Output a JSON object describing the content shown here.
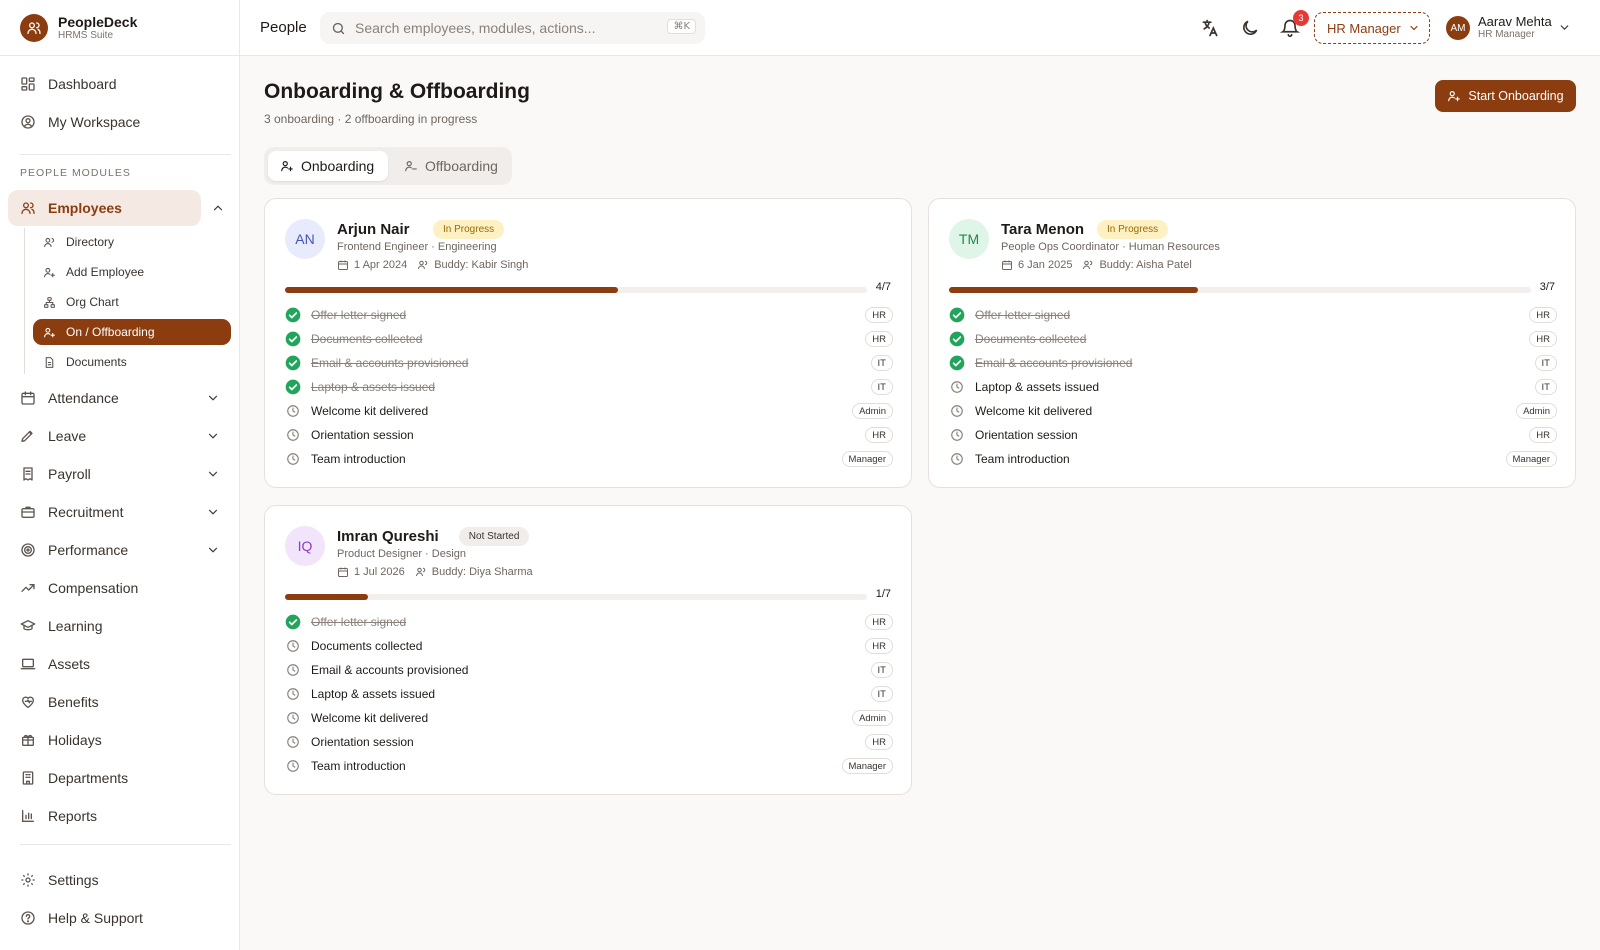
{
  "brand": {
    "name": "PeopleDeck",
    "sub": "HRMS Suite"
  },
  "sidebar": {
    "top_items": [
      {
        "label": "Dashboard"
      },
      {
        "label": "My Workspace"
      }
    ],
    "section_label": "PEOPLE MODULES",
    "employees": {
      "label": "Employees",
      "children": [
        {
          "label": "Directory"
        },
        {
          "label": "Add Employee"
        },
        {
          "label": "Org Chart"
        },
        {
          "label": "On / Offboarding"
        },
        {
          "label": "Documents"
        }
      ]
    },
    "modules": [
      {
        "label": "Attendance"
      },
      {
        "label": "Leave"
      },
      {
        "label": "Payroll"
      },
      {
        "label": "Recruitment"
      },
      {
        "label": "Performance"
      },
      {
        "label": "Compensation"
      },
      {
        "label": "Learning"
      },
      {
        "label": "Assets"
      },
      {
        "label": "Benefits"
      },
      {
        "label": "Holidays"
      },
      {
        "label": "Departments"
      },
      {
        "label": "Reports"
      }
    ],
    "bottom_items": [
      {
        "label": "Settings"
      },
      {
        "label": "Help & Support"
      }
    ]
  },
  "topbar": {
    "title": "People",
    "search_placeholder": "Search employees, modules, actions...",
    "shortcut": "⌘K",
    "notification_count": "3",
    "role": "HR Manager",
    "user": {
      "initials": "AM",
      "name": "Aarav Mehta",
      "role": "HR Manager"
    }
  },
  "page": {
    "title": "Onboarding & Offboarding",
    "subtitle": "3 onboarding · 2 offboarding in progress",
    "primary_action": "Start Onboarding",
    "tabs": [
      {
        "label": "Onboarding"
      },
      {
        "label": "Offboarding"
      }
    ]
  },
  "colors": {
    "accent": "#8b3d10",
    "done": "#22a55b",
    "in_progress_bg": "#fdf1c4",
    "in_progress_fg": "#9a6b00",
    "not_started_bg": "#f1edea",
    "not_started_fg": "#3a332e"
  },
  "cards": [
    {
      "initials": "AN",
      "avatar_bg": "#e7ebfb",
      "avatar_fg": "#4754b8",
      "name": "Arjun Nair",
      "status": "In Progress",
      "role": "Frontend Engineer · Engineering",
      "date": "1 Apr 2024",
      "buddy": "Buddy: Kabir Singh",
      "progress": "4/7",
      "completed": 4,
      "total": 7,
      "tasks": [
        {
          "label": "Offer letter signed",
          "owner": "HR",
          "done": true
        },
        {
          "label": "Documents collected",
          "owner": "HR",
          "done": true
        },
        {
          "label": "Email & accounts provisioned",
          "owner": "IT",
          "done": true
        },
        {
          "label": "Laptop & assets issued",
          "owner": "IT",
          "done": true
        },
        {
          "label": "Welcome kit delivered",
          "owner": "Admin",
          "done": false
        },
        {
          "label": "Orientation session",
          "owner": "HR",
          "done": false
        },
        {
          "label": "Team introduction",
          "owner": "Manager",
          "done": false
        }
      ]
    },
    {
      "initials": "TM",
      "avatar_bg": "#dff5e7",
      "avatar_fg": "#1e8a4c",
      "name": "Tara Menon",
      "status": "In Progress",
      "role": "People Ops Coordinator · Human Resources",
      "date": "6 Jan 2025",
      "buddy": "Buddy: Aisha Patel",
      "progress": "3/7",
      "completed": 3,
      "total": 7,
      "tasks": [
        {
          "label": "Offer letter signed",
          "owner": "HR",
          "done": true
        },
        {
          "label": "Documents collected",
          "owner": "HR",
          "done": true
        },
        {
          "label": "Email & accounts provisioned",
          "owner": "IT",
          "done": true
        },
        {
          "label": "Laptop & assets issued",
          "owner": "IT",
          "done": false
        },
        {
          "label": "Welcome kit delivered",
          "owner": "Admin",
          "done": false
        },
        {
          "label": "Orientation session",
          "owner": "HR",
          "done": false
        },
        {
          "label": "Team introduction",
          "owner": "Manager",
          "done": false
        }
      ]
    },
    {
      "initials": "IQ",
      "avatar_bg": "#f1e4fb",
      "avatar_fg": "#8a3fc4",
      "name": "Imran Qureshi",
      "status": "Not Started",
      "role": "Product Designer · Design",
      "date": "1 Jul 2026",
      "buddy": "Buddy: Diya Sharma",
      "progress": "1/7",
      "completed": 1,
      "total": 7,
      "tasks": [
        {
          "label": "Offer letter signed",
          "owner": "HR",
          "done": true
        },
        {
          "label": "Documents collected",
          "owner": "HR",
          "done": false
        },
        {
          "label": "Email & accounts provisioned",
          "owner": "IT",
          "done": false
        },
        {
          "label": "Laptop & assets issued",
          "owner": "IT",
          "done": false
        },
        {
          "label": "Welcome kit delivered",
          "owner": "Admin",
          "done": false
        },
        {
          "label": "Orientation session",
          "owner": "HR",
          "done": false
        },
        {
          "label": "Team introduction",
          "owner": "Manager",
          "done": false
        }
      ]
    }
  ]
}
